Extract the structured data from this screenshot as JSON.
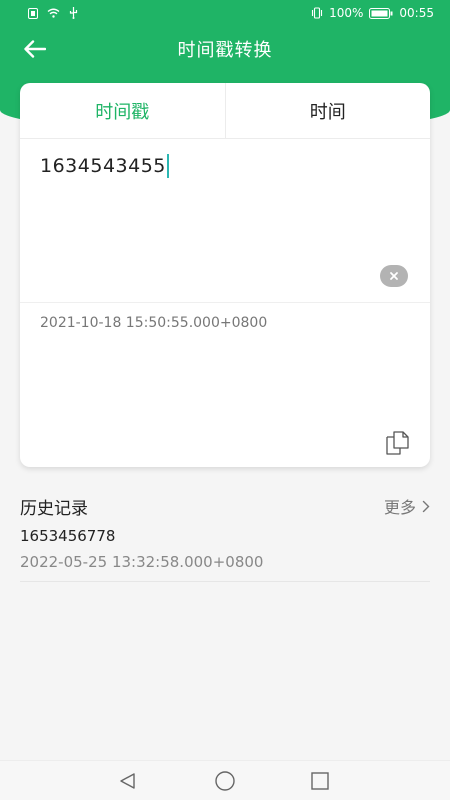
{
  "colors": {
    "accent": "#1fb466",
    "caret": "#2bb7b3",
    "background": "#f5f5f5"
  },
  "status_bar": {
    "battery_percent": "100%",
    "time": "00:55",
    "icons": [
      "sim-icon",
      "wifi-icon",
      "usb-icon",
      "vibrate-icon",
      "battery-icon"
    ]
  },
  "app_bar": {
    "title": "时间戳转换",
    "back_icon": "arrow-left-icon"
  },
  "tabs": [
    {
      "label": "时间戳",
      "active": true
    },
    {
      "label": "时间",
      "active": false
    }
  ],
  "input": {
    "value": "1634543455",
    "clear_icon": "close-icon"
  },
  "result": {
    "value": "2021-10-18 15:50:55.000+0800",
    "copy_icon": "copy-icon"
  },
  "history": {
    "title": "历史记录",
    "more_label": "更多",
    "more_icon": "chevron-right-icon",
    "items": [
      {
        "timestamp": "1653456778",
        "datetime": "2022-05-25 13:32:58.000+0800"
      }
    ]
  },
  "nav_bar": {
    "buttons": [
      "back-triangle-icon",
      "home-circle-icon",
      "recents-square-icon"
    ]
  }
}
